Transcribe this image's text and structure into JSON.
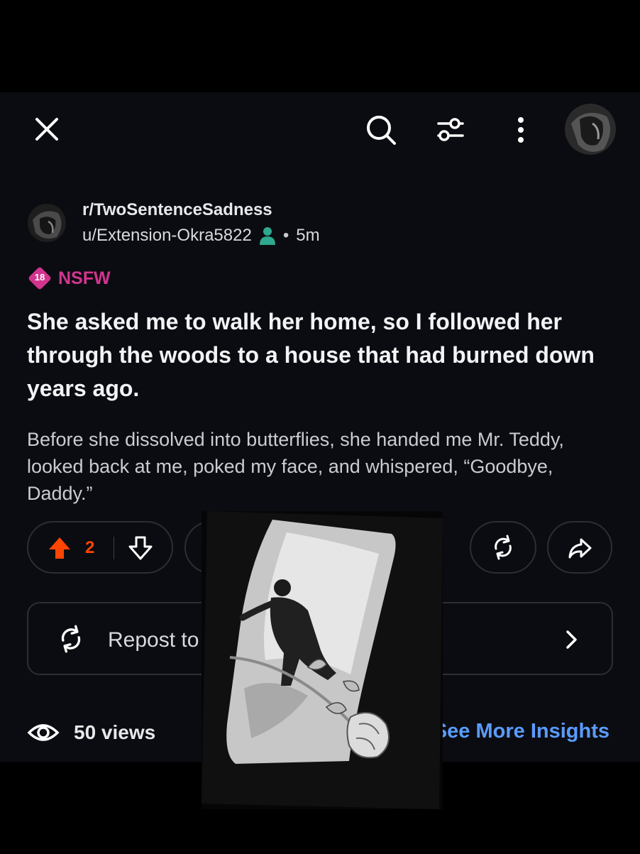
{
  "header": {
    "close_icon": "close-icon",
    "search_icon": "search-icon",
    "filter_icon": "sliders-icon",
    "more_icon": "more-vertical-icon",
    "avatar": "user-avatar"
  },
  "post": {
    "subreddit": "r/TwoSentenceSadness",
    "author": "u/Extension-Okra5822",
    "separator": "•",
    "time_ago": "5m",
    "nsfw_badge_number": "18",
    "nsfw_label": "NSFW",
    "title": "She asked me to walk her home, so I followed her through the woods to a house that had burned down years ago.",
    "body": "Before she dissolved into butterflies, she handed me Mr. Teddy, looked back at me, poked my face, and whispered, “Goodbye, Daddy.”"
  },
  "actions": {
    "upvotes": "2",
    "repost_label": "Repost to",
    "views_label": "50 views",
    "insights_label": "See More Insights"
  },
  "colors": {
    "background": "#0b0c11",
    "upvote": "#ff4500",
    "nsfw": "#d2348f",
    "link": "#5a9cff"
  }
}
